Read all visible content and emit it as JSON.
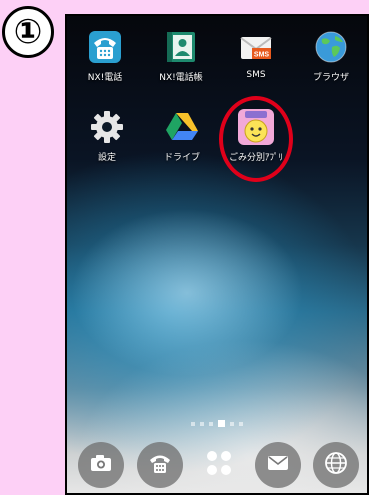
{
  "step_marker": "①",
  "apps": [
    {
      "label": "NX!電話",
      "icon": "phone-icon"
    },
    {
      "label": "NX!電話帳",
      "icon": "contacts-icon"
    },
    {
      "label": "SMS",
      "icon": "sms-icon"
    },
    {
      "label": "ブラウザ",
      "icon": "globe-icon"
    },
    {
      "label": "設定",
      "icon": "gear-icon"
    },
    {
      "label": "ドライブ",
      "icon": "drive-icon"
    },
    {
      "label": "ごみ分別ｱﾌﾟﾘ",
      "icon": "garbage-app-icon"
    }
  ],
  "page_indicator": {
    "count": 6,
    "active": 3
  },
  "dock": [
    {
      "name": "camera",
      "icon": "camera-icon"
    },
    {
      "name": "phone",
      "icon": "phone-icon"
    },
    {
      "name": "app-drawer",
      "icon": "app-drawer-icon"
    },
    {
      "name": "mail",
      "icon": "mail-icon"
    },
    {
      "name": "browser",
      "icon": "globe-icon"
    }
  ],
  "colors": {
    "highlight": "#e0001a",
    "page_background": "#fdd0f6"
  }
}
